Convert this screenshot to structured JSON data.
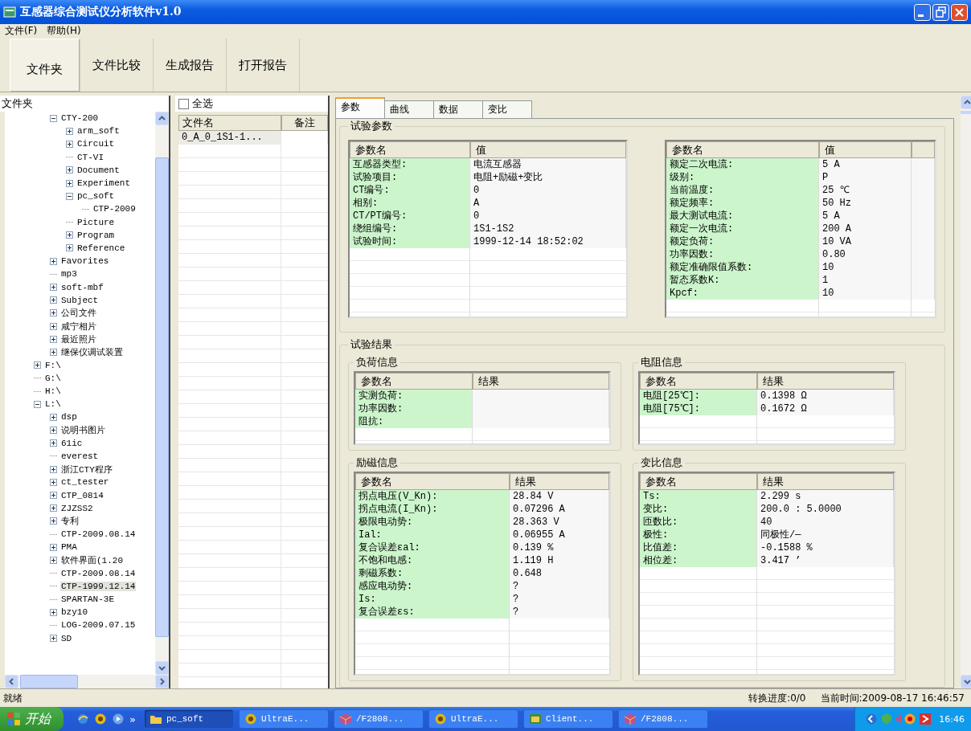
{
  "window": {
    "title": "互感器综合测试仪分析软件v1.0"
  },
  "menu": [
    "文件(F)",
    "帮助(H)"
  ],
  "toolbar": [
    {
      "label": "文件夹",
      "selected": true
    },
    {
      "label": "文件比较",
      "selected": false
    },
    {
      "label": "生成报告",
      "selected": false
    },
    {
      "label": "打开报告",
      "selected": false
    }
  ],
  "tree": {
    "title": "文件夹",
    "items": [
      {
        "children": [
          {
            "label": "CTY-200",
            "kind": "branch",
            "expanded": true,
            "selected": false,
            "children": [
              {
                "label": "arm_soft",
                "kind": "branch",
                "expanded": false,
                "selected": false
              },
              {
                "label": "Circuit",
                "kind": "branch",
                "expanded": false,
                "selected": false
              },
              {
                "label": "CT-VI",
                "kind": "leaf",
                "selected": false
              },
              {
                "label": "Document",
                "kind": "branch",
                "expanded": false,
                "selected": false
              },
              {
                "label": "Experiment",
                "kind": "branch",
                "expanded": false,
                "selected": false
              },
              {
                "label": "pc_soft",
                "kind": "branch",
                "expanded": true,
                "selected": false,
                "children": [
                  {
                    "label": "CTP-2009",
                    "kind": "leaf",
                    "selected": false
                  }
                ]
              },
              {
                "label": "Picture",
                "kind": "leaf",
                "selected": false
              },
              {
                "label": "Program",
                "kind": "branch",
                "expanded": false,
                "selected": false
              },
              {
                "label": "Reference",
                "kind": "branch",
                "expanded": false,
                "selected": false
              }
            ]
          },
          {
            "label": "Favorites",
            "kind": "branch",
            "expanded": false,
            "selected": false
          },
          {
            "label": "mp3",
            "kind": "leaf",
            "selected": false
          },
          {
            "label": "soft-mbf",
            "kind": "branch",
            "expanded": false,
            "selected": false
          },
          {
            "label": "Subject",
            "kind": "branch",
            "expanded": false,
            "selected": false
          },
          {
            "label": "公司文件",
            "kind": "branch",
            "expanded": false,
            "selected": false
          },
          {
            "label": "咸宁相片",
            "kind": "branch",
            "expanded": false,
            "selected": false
          },
          {
            "label": "最近照片",
            "kind": "branch",
            "expanded": false,
            "selected": false
          },
          {
            "label": "继保仪调试装置",
            "kind": "branch",
            "expanded": false,
            "selected": false
          }
        ]
      },
      {
        "label": "F:\\",
        "kind": "branch",
        "expanded": false,
        "selected": false
      },
      {
        "label": "G:\\",
        "kind": "leaf",
        "selected": false
      },
      {
        "label": "H:\\",
        "kind": "leaf",
        "selected": false
      },
      {
        "label": "L:\\",
        "kind": "branch",
        "expanded": true,
        "selected": false,
        "children": [
          {
            "label": "dsp",
            "kind": "branch",
            "expanded": false,
            "selected": false
          },
          {
            "label": "说明书图片",
            "kind": "branch",
            "expanded": false,
            "selected": false
          },
          {
            "label": "61ic",
            "kind": "branch",
            "expanded": false,
            "selected": false
          },
          {
            "label": "everest",
            "kind": "leaf",
            "selected": false
          },
          {
            "label": "浙江CTY程序",
            "kind": "branch",
            "expanded": false,
            "selected": false
          },
          {
            "label": "ct_tester",
            "kind": "branch",
            "expanded": false,
            "selected": false
          },
          {
            "label": "CTP_0814",
            "kind": "branch",
            "expanded": false,
            "selected": false
          },
          {
            "label": "ZJZSS2",
            "kind": "branch",
            "expanded": false,
            "selected": false
          },
          {
            "label": "专利",
            "kind": "branch",
            "expanded": false,
            "selected": false
          },
          {
            "label": "CTP-2009.08.14",
            "kind": "leaf",
            "selected": false
          },
          {
            "label": "PMA",
            "kind": "branch",
            "expanded": false,
            "selected": false
          },
          {
            "label": "软件界面(1.20",
            "kind": "branch",
            "expanded": false,
            "selected": false
          },
          {
            "label": "CTP-2009.08.14",
            "kind": "leaf",
            "selected": false
          },
          {
            "label": "CTP-1999.12.14",
            "kind": "leaf",
            "selected": true
          },
          {
            "label": "SPARTAN-3E",
            "kind": "leaf",
            "selected": false
          },
          {
            "label": "bzy10",
            "kind": "branch",
            "expanded": false,
            "selected": false
          },
          {
            "label": "LOG-2009.07.15",
            "kind": "leaf",
            "selected": false
          },
          {
            "label": "SD",
            "kind": "branch",
            "expanded": false,
            "selected": false
          }
        ]
      }
    ]
  },
  "file_list": {
    "select_all": {
      "label": "全选",
      "checked": false
    },
    "columns": [
      "文件名",
      "备注"
    ],
    "rows": [
      {
        "name": "0_A_0_1S1-1...",
        "selected": true
      }
    ]
  },
  "tabs": [
    {
      "label": "参数",
      "selected": true
    },
    {
      "label": "曲线",
      "selected": false
    },
    {
      "label": "数据",
      "selected": false
    },
    {
      "label": "变比",
      "selected": false
    }
  ],
  "test_params": {
    "title": "试验参数",
    "tables": [
      {
        "columns": [
          "参数名",
          "值"
        ],
        "rows": [
          {
            "name": "互感器类型:",
            "value": "电流互感器"
          },
          {
            "name": "试验项目:",
            "value": "电阻+励磁+变比"
          },
          {
            "name": "CT编号:",
            "value": "0"
          },
          {
            "name": "相别:",
            "value": "A"
          },
          {
            "name": "CT/PT编号:",
            "value": "0"
          },
          {
            "name": "绕组编号:",
            "value": "1S1-1S2"
          },
          {
            "name": "试验时间:",
            "value": "1999-12-14 18:52:02"
          }
        ]
      },
      {
        "columns": [
          "参数名",
          "值"
        ],
        "rows": [
          {
            "name": "额定二次电流:",
            "value": "5 A"
          },
          {
            "name": "级别:",
            "value": "P"
          },
          {
            "name": "当前温度:",
            "value": "25 ℃"
          },
          {
            "name": "额定频率:",
            "value": "50 Hz"
          },
          {
            "name": "最大测试电流:",
            "value": "5 A"
          },
          {
            "name": "额定一次电流:",
            "value": "200 A"
          },
          {
            "name": "额定负荷:",
            "value": "10 VA"
          },
          {
            "name": "功率因数:",
            "value": "0.80"
          },
          {
            "name": "额定准确限值系数:",
            "value": "10"
          },
          {
            "name": "暂态系数K:",
            "value": "1"
          },
          {
            "name": "Kpcf:",
            "value": "10"
          }
        ]
      }
    ]
  },
  "test_results": {
    "title": "试验结果",
    "groups": [
      {
        "title": "负荷信息",
        "columns": [
          "参数名",
          "结果"
        ],
        "rows": [
          {
            "name": "实测负荷:"
          },
          {
            "name": "功率因数:"
          },
          {
            "name": "阻抗:"
          }
        ]
      },
      {
        "title": "电阻信息",
        "columns": [
          "参数名",
          "结果"
        ],
        "rows": [
          {
            "name": "电阻[25℃]:",
            "value": "0.1398 Ω"
          },
          {
            "name": "电阻[75℃]:",
            "value": "0.1672 Ω"
          }
        ]
      },
      {
        "title": "励磁信息",
        "columns": [
          "参数名",
          "结果"
        ],
        "rows": [
          {
            "name": "拐点电压(V_Kn):",
            "value": "28.84 V"
          },
          {
            "name": "拐点电流(I_Kn):",
            "value": "0.07296 A"
          },
          {
            "name": "极限电动势:",
            "value": "28.363 V"
          },
          {
            "name": "Ial:",
            "value": "0.06955 A"
          },
          {
            "name": "复合误差εal:",
            "value": "0.139 %"
          },
          {
            "name": "不饱和电感:",
            "value": "1.119 H"
          },
          {
            "name": "剩磁系数:",
            "value": "0.648"
          },
          {
            "name": "感应电动势:",
            "value": "?"
          },
          {
            "name": "Is:",
            "value": "?"
          },
          {
            "name": "复合误差εs:",
            "value": "?"
          }
        ]
      },
      {
        "title": "变比信息",
        "columns": [
          "参数名",
          "结果"
        ],
        "rows": [
          {
            "name": "Ts:",
            "value": "2.299 s"
          },
          {
            "name": "变比:",
            "value": "200.0 : 5.0000"
          },
          {
            "name": "匝数比:",
            "value": "40"
          },
          {
            "name": "极性:",
            "value": "同极性/—"
          },
          {
            "name": "比值差:",
            "value": "-0.1588 %"
          },
          {
            "name": "相位差:",
            "value": "3.417 ’"
          }
        ]
      }
    ]
  },
  "status_bar": {
    "message": "就绪",
    "progress": "转换进度:0/0",
    "time": "当前时间:2009-08-17 16:46:57"
  },
  "taskbar": {
    "start": "开始",
    "chevron": "»",
    "tasks": [
      {
        "label": "pc_soft",
        "kind": "folder",
        "selected": true
      },
      {
        "label": "UltraE...",
        "kind": "globe",
        "selected": false
      },
      {
        "label": "/F2808...",
        "kind": "cube",
        "selected": false
      },
      {
        "label": "UltraE...",
        "kind": "globe",
        "selected": false
      },
      {
        "label": "Client...",
        "kind": "client",
        "selected": false
      },
      {
        "label": "/F2808...",
        "kind": "cube",
        "selected": false
      }
    ],
    "clock": "16:46"
  }
}
